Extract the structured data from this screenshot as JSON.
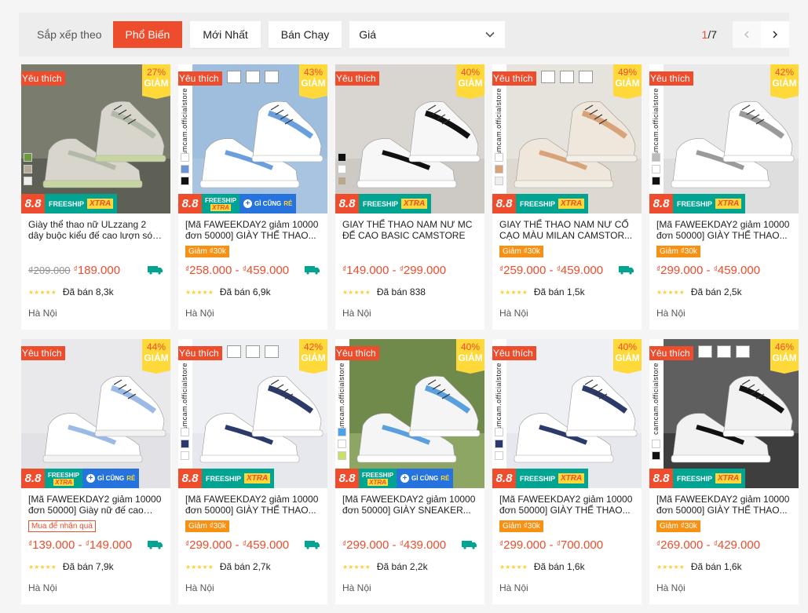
{
  "sort": {
    "label": "Sắp xếp theo",
    "options": [
      "Phổ Biến",
      "Mới Nhất",
      "Bán Chạy"
    ],
    "active": "Phổ Biến",
    "price_label": "Giá",
    "page_current": "1",
    "page_total": "/7"
  },
  "colors": {
    "accent": "#ee4d2d",
    "freeship": "#01a490",
    "voucher": "#f69113",
    "star": "#ffce3d"
  },
  "badges": {
    "favorite": "Yêu thích",
    "discount_label": "GIẢM",
    "mall_88": "8.8",
    "freeship": "FREESHIP",
    "xtra": "XTRA",
    "gicung": "GÌ CŨNG",
    "re": "RẺ",
    "brand": "camcam.officialstore",
    "currency": "₫",
    "stars": "★★★★★"
  },
  "products": [
    {
      "title": "Giày thể thao nữ ULzzang 2 dây buộc kiểu đế cao lượn sóng m...",
      "discount": "27%",
      "old_price": "₫209.000",
      "price_min": "189.000",
      "price_max": "",
      "tag": "",
      "sold": "Đã bán 8,3k",
      "location": "Hà Nội",
      "promo": "freeship",
      "free_ship_icon": true,
      "brand": false,
      "certs": false,
      "swatches": [
        "#6a9a3a",
        "#b5a99a",
        "#eeeeee"
      ]
    },
    {
      "title": "[Mã FAWEEKDAY2 giảm 10000 đơn 50000] GIÀY THỂ THAO...",
      "discount": "43%",
      "old_price": "",
      "price_min": "258.000",
      "price_max": "459.000",
      "tag": "Giảm ₫30k",
      "sold": "Đã bán 6,9k",
      "location": "Hà Nội",
      "promo": "freeship2",
      "free_ship_icon": true,
      "brand": true,
      "certs": true,
      "swatches": [
        "#ffffff",
        "#6b93d6",
        "#111111"
      ]
    },
    {
      "title": "GIAY THỂ THAO NAM NƯ MC ĐẾ CAO BASIC CAMSTORE",
      "discount": "40%",
      "old_price": "",
      "price_min": "149.000",
      "price_max": "299.000",
      "tag": "",
      "sold": "Đã bán 838",
      "location": "Hà Nội",
      "promo": "freeship",
      "free_ship_icon": false,
      "brand": false,
      "certs": false,
      "swatches": [
        "#111111",
        "#ffffff",
        "#b9a98a"
      ]
    },
    {
      "title": "GIAY THỂ THAO NAM NƯ CỔ CẠO MÀU MILAN CAMSTOR...",
      "discount": "49%",
      "old_price": "",
      "price_min": "259.000",
      "price_max": "459.000",
      "tag": "Giảm ₫30k",
      "sold": "Đã bán 1,5k",
      "location": "Hà Nội",
      "promo": "freeship",
      "free_ship_icon": true,
      "brand": true,
      "certs": true,
      "swatches": [
        "#ffffff",
        "#d9a37a",
        "#eeeeee"
      ]
    },
    {
      "title": "[Mã FAWEEKDAY2 giảm 10000 đơn 50000] GIÀY THỂ THAO...",
      "discount": "42%",
      "old_price": "",
      "price_min": "299.000",
      "price_max": "459.000",
      "tag": "Giảm ₫30k",
      "sold": "Đã bán 2,5k",
      "location": "Hà Nội",
      "promo": "freeship",
      "free_ship_icon": false,
      "brand": true,
      "certs": false,
      "swatches": [
        "#bbbbbb",
        "#ffffff",
        "#111111"
      ]
    },
    {
      "title": "[Mã FAWEEKDAY2 giảm 10000 đơn 50000] Giày nữ đế cao ha...",
      "discount": "44%",
      "old_price": "",
      "price_min": "139.000",
      "price_max": "149.000",
      "tag": "Mua để nhận quà",
      "sold": "Đã bán 7,9k",
      "location": "Hà Nội",
      "promo": "freeship2",
      "free_ship_icon": true,
      "brand": false,
      "certs": false,
      "swatches": []
    },
    {
      "title": "[Mã FAWEEKDAY2 giảm 10000 đơn 50000] GIÀY THỂ THAO...",
      "discount": "42%",
      "old_price": "",
      "price_min": "299.000",
      "price_max": "459.000",
      "tag": "Giảm ₫30k",
      "sold": "Đã bán 2,7k",
      "location": "Hà Nội",
      "promo": "freeship",
      "free_ship_icon": true,
      "brand": true,
      "certs": true,
      "swatches": [
        "#ffffff",
        "#2b3a6b",
        "#ffffff"
      ]
    },
    {
      "title": "[Mã FAWEEKDAY2 giảm 10000 đơn 50000] GIÀY SNEAKER...",
      "discount": "40%",
      "old_price": "",
      "price_min": "299.000",
      "price_max": "439.000",
      "tag": "",
      "sold": "Đã bán 2,2k",
      "location": "Hà Nội",
      "promo": "freeship2",
      "free_ship_icon": true,
      "brand": true,
      "certs": false,
      "swatches": [
        "#4aa3e8",
        "#ffffff",
        "#c8e06a"
      ]
    },
    {
      "title": "[Mã FAWEEKDAY2 giảm 10000 đơn 50000] GIÀY THỂ THAO...",
      "discount": "40%",
      "old_price": "",
      "price_min": "299.000",
      "price_max": "700.000",
      "tag": "Giảm ₫30k",
      "sold": "Đã bán 1,6k",
      "location": "Hà Nội",
      "promo": "freeship",
      "free_ship_icon": false,
      "brand": true,
      "certs": false,
      "swatches": [
        "#ffffff",
        "#2b3a6b",
        "#ffffff"
      ]
    },
    {
      "title": "[Mã FAWEEKDAY2 giảm 10000 đơn 50000] GIÀY THỂ THAO...",
      "discount": "46%",
      "old_price": "",
      "price_min": "269.000",
      "price_max": "429.000",
      "tag": "Giảm ₫30k",
      "sold": "Đã bán 1,6k",
      "location": "Hà Nội",
      "promo": "freeship",
      "free_ship_icon": false,
      "brand": true,
      "certs": true,
      "swatches": [
        "#ffffff",
        "#111111"
      ]
    }
  ]
}
